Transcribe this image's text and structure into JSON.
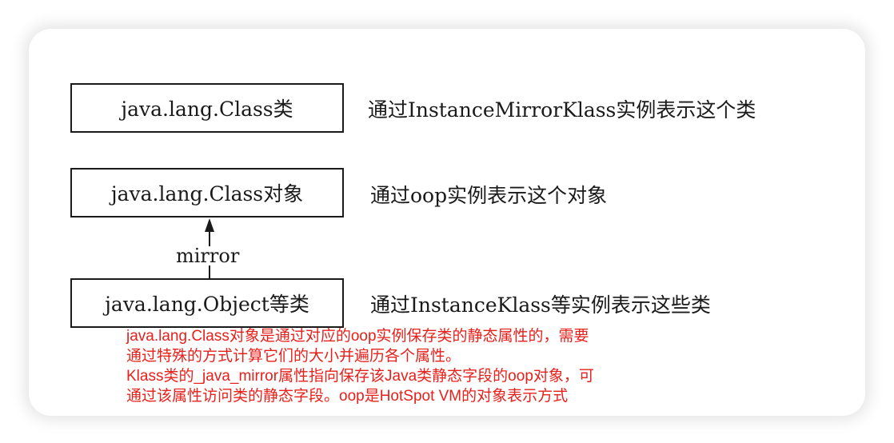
{
  "boxes": {
    "class_type": "java.lang.Class类",
    "class_object": "java.lang.Class对象",
    "object_types": "java.lang.Object等类"
  },
  "descriptions": {
    "class_type": "通过InstanceMirrorKlass实例表示这个类",
    "class_object": "通过oop实例表示这个对象",
    "object_types": "通过InstanceKlass等实例表示这些类"
  },
  "edge_label": "mirror",
  "note_lines": [
    "java.lang.Class对象是通过对应的oop实例保存类的静态属性的，需要",
    "通过特殊的方式计算它们的大小并遍历各个属性。",
    "Klass类的_java_mirror属性指向保存该Java类静态字段的oop对象，可",
    "通过该属性访问类的静态字段。oop是HotSpot VM的对象表示方式"
  ],
  "colors": {
    "note": "#e8201b",
    "lines": "#1a1a1a"
  }
}
